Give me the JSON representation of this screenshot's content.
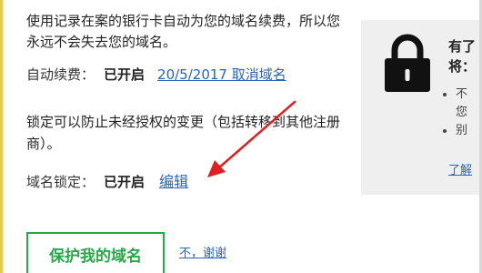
{
  "autorenew": {
    "description": "使用记录在案的银行卡自动为您的域名续费，所以您永远不会失去您的域名。",
    "label": "自动续费：",
    "status": "已开启",
    "date_link": "20/5/2017 取消域名"
  },
  "domain_lock": {
    "description": "锁定可以防止未经授权的变更（包括转移到其他注册商）。",
    "label": "域名锁定：",
    "status": "已开启",
    "edit_link": "编辑"
  },
  "actions": {
    "protect_button": "保护我的域名",
    "no_thanks": "不，谢谢"
  },
  "info_box": {
    "title_line1": "有了",
    "title_line2": "将：",
    "bullets": [
      "不",
      "您",
      "别"
    ],
    "learn_more": "了解"
  },
  "colors": {
    "accent_green": "#27a84a",
    "link_blue": "#2a64b8",
    "annotation_red": "#e02020",
    "box_gray": "#efefef"
  },
  "icons": {
    "info_box_icon": "lock-icon",
    "annotation": "red-arrow-annotation"
  }
}
